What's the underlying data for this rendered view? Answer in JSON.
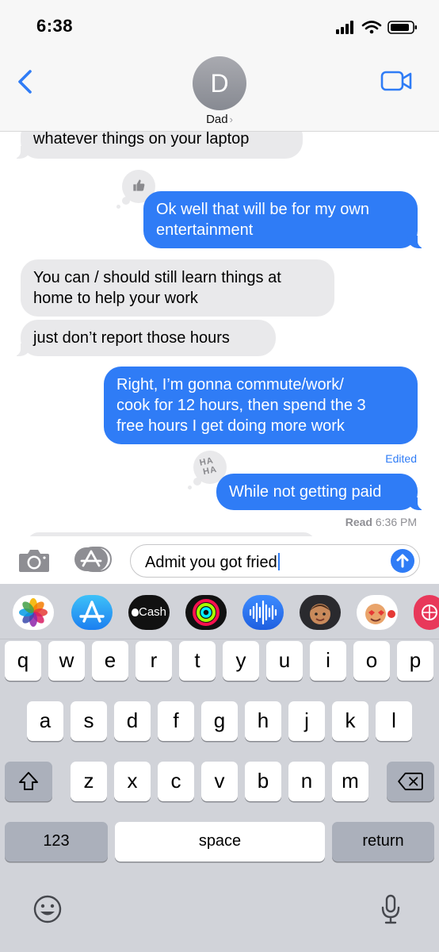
{
  "status_bar": {
    "time": "6:38"
  },
  "header": {
    "avatar_initial": "D",
    "contact_name": "Dad",
    "name_chevron": "›",
    "icons": [
      "chevron-left-icon",
      "video-camera-icon"
    ]
  },
  "messages": [
    {
      "direction": "incoming",
      "text": "whatever things on your laptop"
    },
    {
      "direction": "outgoing",
      "lines": [
        "Ok well that will be for my own",
        "entertainment"
      ],
      "tapback": "thumbs-up"
    },
    {
      "direction": "incoming",
      "lines": [
        "You can / should still learn things at",
        "home to help your work"
      ]
    },
    {
      "direction": "incoming",
      "text": "just don’t report those hours"
    },
    {
      "direction": "outgoing",
      "lines": [
        "Right, I’m gonna commute/work/",
        "cook for 12 hours, then spend the 3",
        "free hours I get doing more work"
      ]
    },
    {
      "direction": "outgoing",
      "text": "While not getting paid",
      "tapback": "haha"
    }
  ],
  "edited_label": "Edited",
  "read_receipt": {
    "label": "Read",
    "time": "6:36 PM"
  },
  "haha_lines": [
    "HA",
    "HA"
  ],
  "composer": {
    "text": "Admit you got fried"
  },
  "apps": [
    "Photos",
    "App Store",
    "Cash",
    "Activity",
    "Audio",
    "Memoji",
    "Memoji Stickers",
    "Web"
  ],
  "cash_label": "Cash",
  "keyboard": {
    "row1": [
      "q",
      "w",
      "e",
      "r",
      "t",
      "y",
      "u",
      "i",
      "o",
      "p"
    ],
    "row2": [
      "a",
      "s",
      "d",
      "f",
      "g",
      "h",
      "j",
      "k",
      "l"
    ],
    "row3": [
      "z",
      "x",
      "c",
      "v",
      "b",
      "n",
      "m"
    ],
    "numbers_key": "123",
    "space_key": "space",
    "return_key": "return"
  },
  "colors": {
    "blue": "#2f7cf6",
    "incoming_gray": "#e9e9eb",
    "keyboard_bg": "#d1d3d9"
  }
}
